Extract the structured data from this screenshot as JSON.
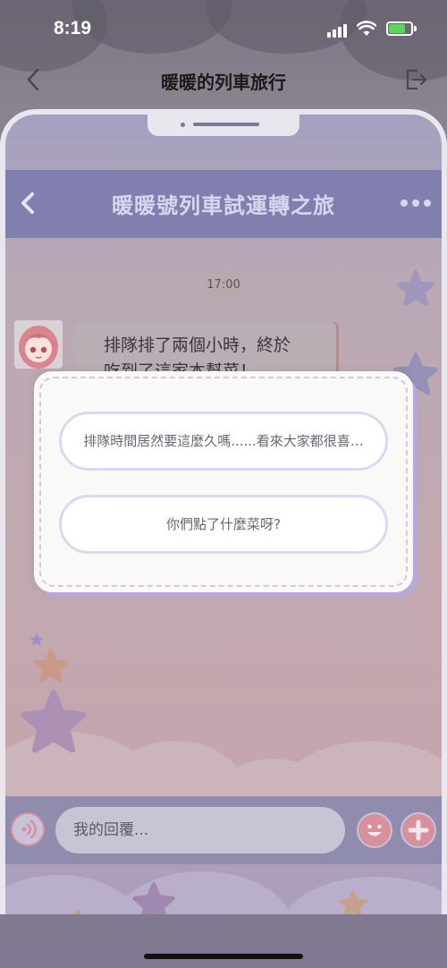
{
  "status_bar": {
    "time": "8:19"
  },
  "app_header": {
    "title": "暖暖的列車旅行"
  },
  "chat": {
    "title": "暖暖號列車試運轉之旅",
    "timestamp": "17:00",
    "messages": [
      {
        "text_line1": "排隊排了兩個小時，終於",
        "text_line2": "吃到了這家本幫菜！"
      }
    ]
  },
  "choices": [
    {
      "label": "排隊時間居然要這麼久嗎......看來大家都很喜…"
    },
    {
      "label": "你們點了什麼菜呀?"
    }
  ],
  "input": {
    "placeholder": "我的回覆..."
  },
  "icons": {
    "back": "chevron-left-icon",
    "exit": "exit-icon",
    "more": "more-dots-icon",
    "voice": "voice-icon",
    "emoji": "smile-icon",
    "plus": "plus-icon"
  },
  "colors": {
    "chat_header": "#807fae",
    "option_border": "#dcd7f2",
    "accent_pink": "#d8909c"
  }
}
